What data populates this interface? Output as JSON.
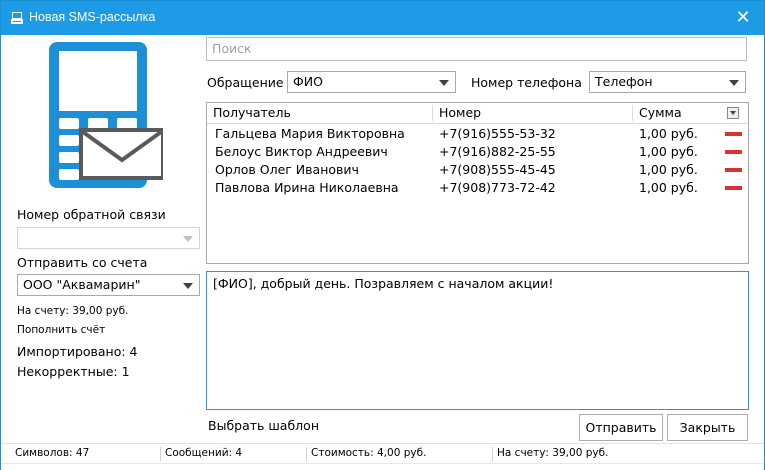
{
  "window": {
    "title": "Новая SMS-рассылка",
    "accent": "#1e9be6"
  },
  "search": {
    "placeholder": "Поиск"
  },
  "appeal": {
    "label": "Обращение",
    "value": "ФИО"
  },
  "phone_field": {
    "label": "Номер телефона",
    "value": "Телефон"
  },
  "left": {
    "callback_label": "Номер обратной связи",
    "callback_value": "",
    "account_label": "Отправить со счета",
    "account_value": "ООО \"Аквамарин\"",
    "balance": "На счету: 39,00 руб.",
    "topup": "Пополнить счёт",
    "imported": "Импортировано: 4",
    "invalid": "Некорректные: 1"
  },
  "grid": {
    "columns": [
      "Получатель",
      "Номер",
      "Сумма"
    ],
    "rows": [
      {
        "name": "Гальцева Мария Викторовна",
        "phone": "+7(916)555-53-32",
        "sum": "1,00 руб."
      },
      {
        "name": "Белоус Виктор Андреевич",
        "phone": "+7(916)882-25-55",
        "sum": "1,00 руб."
      },
      {
        "name": "Орлов Олег Иванович",
        "phone": "+7(908)555-45-45",
        "sum": "1,00 руб."
      },
      {
        "name": "Павлова Ирина Николаевна",
        "phone": "+7(908)773-72-42",
        "sum": "1,00 руб."
      }
    ]
  },
  "message": {
    "text": "[ФИО], добрый день. Позравляем с началом акции!"
  },
  "template_link": "Выбрать шаблон",
  "buttons": {
    "send": "Отправить",
    "close": "Закрыть"
  },
  "statusbar": {
    "chars": "Символов: 47",
    "messages": "Сообщений: 4",
    "cost": "Стоимость: 4,00 руб.",
    "balance": "На счету: 39,00 руб."
  }
}
